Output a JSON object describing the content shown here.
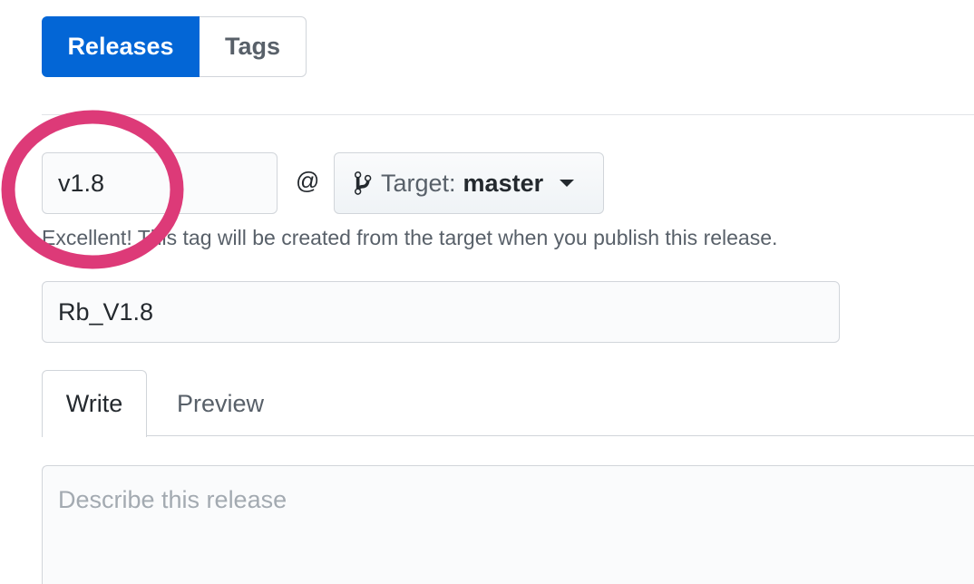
{
  "segmented": {
    "releases_label": "Releases",
    "tags_label": "Tags"
  },
  "release_form": {
    "tag_value": "v1.8",
    "at_symbol": "@",
    "target_prefix": "Target:",
    "target_branch": "master",
    "tag_hint": "Excellent! This tag will be created from the target when you publish this release.",
    "title_value": "Rb_V1.8",
    "description_placeholder": "Describe this release"
  },
  "editor_tabs": {
    "write_label": "Write",
    "preview_label": "Preview"
  },
  "icons": {
    "branch": "git-branch-icon",
    "caret": "caret-down-icon"
  },
  "colors": {
    "accent": "#0366d6",
    "highlight_circle": "#dd3a78"
  }
}
